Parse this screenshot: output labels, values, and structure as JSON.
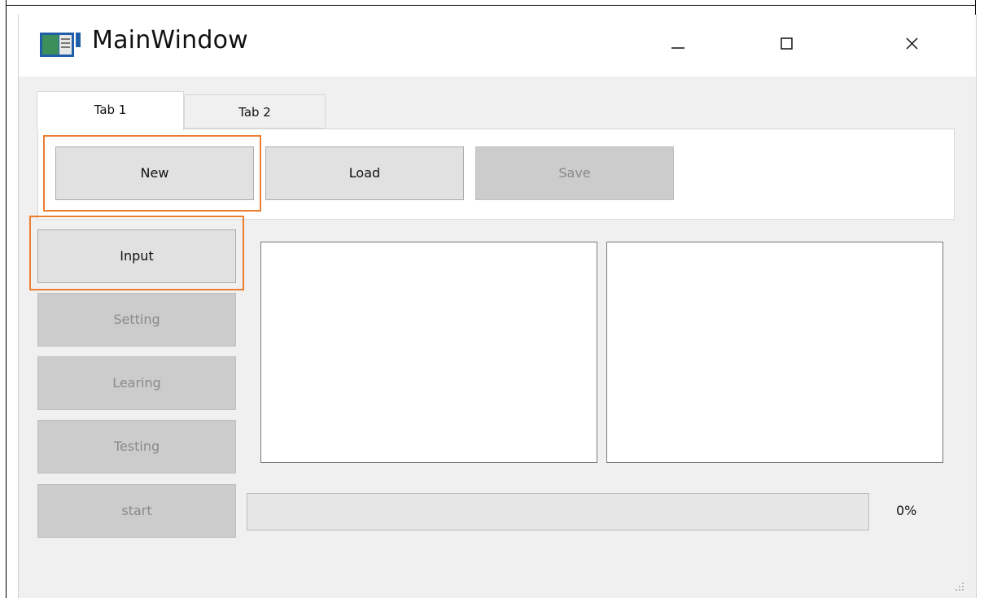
{
  "window": {
    "title": "MainWindow",
    "controls": [
      "minimize-icon",
      "maximize-icon",
      "close-icon"
    ]
  },
  "tabs": [
    {
      "label": "Tab 1",
      "selected": true
    },
    {
      "label": "Tab 2",
      "selected": false
    }
  ],
  "toolbar": {
    "new_label": "New",
    "load_label": "Load",
    "save_label": "Save"
  },
  "sidebar": {
    "input_label": "Input",
    "setting_label": "Setting",
    "learing_label": "Learing",
    "testing_label": "Testing",
    "start_label": "start"
  },
  "progress": {
    "value": 0,
    "label": "0%"
  },
  "colors": {
    "highlight": "#ed7d31",
    "window_bg": "#f0f0f0",
    "disabled_text": "#8a8a8a"
  }
}
